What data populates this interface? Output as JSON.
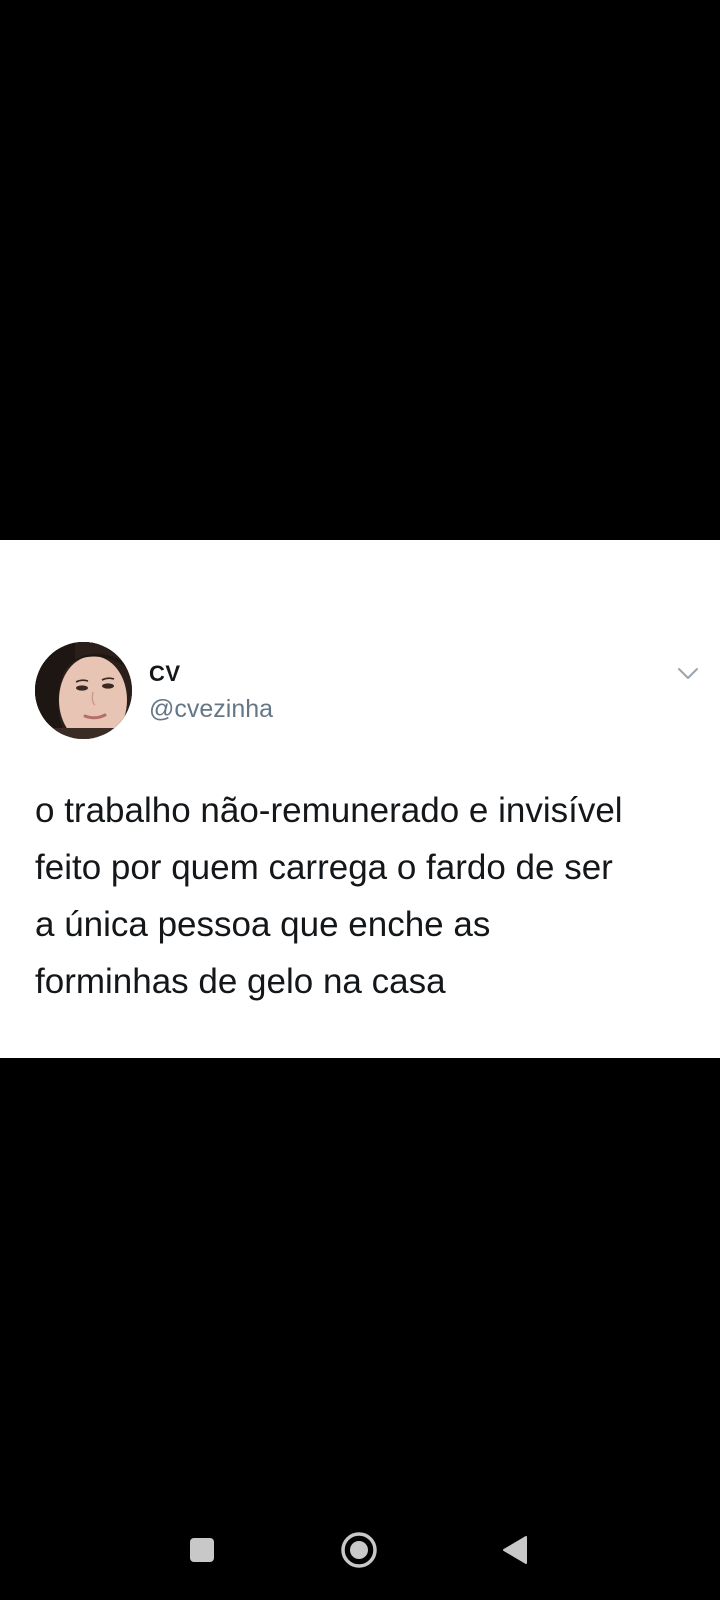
{
  "tweet": {
    "author_name": "CV",
    "author_handle": "@cvezinha",
    "text_lines": [
      "o trabalho não-remunerado e invisível",
      "feito por quem carrega o fardo de ser",
      "a única pessoa que enche as",
      "forminhas de gelo na casa"
    ],
    "menu_icon": "chevron-down-icon",
    "avatar": "profile-photo"
  },
  "system_nav": {
    "buttons": [
      {
        "name": "recents",
        "icon": "square-icon"
      },
      {
        "name": "home",
        "icon": "circle-icon"
      },
      {
        "name": "back",
        "icon": "triangle-back-icon"
      }
    ]
  },
  "colors": {
    "background": "#000000",
    "card": "#ffffff",
    "text": "#14171a",
    "secondary_text": "#657786",
    "nav_icons": "#c8c8c8"
  }
}
